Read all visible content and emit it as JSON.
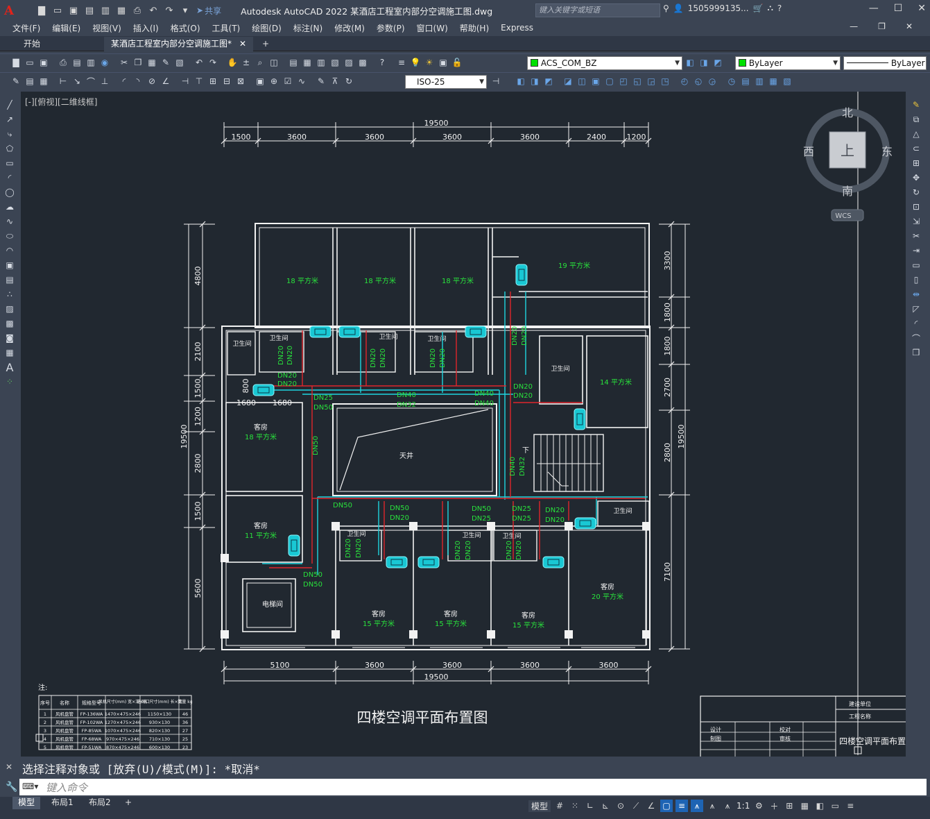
{
  "app": {
    "logo": "A",
    "share": "共享",
    "title": "Autodesk AutoCAD 2022    某酒店工程室内部分空调施工图.dwg",
    "search_placeholder": "键入关键字或短语",
    "user": "1505999135..."
  },
  "menu": [
    "文件(F)",
    "编辑(E)",
    "视图(V)",
    "插入(I)",
    "格式(O)",
    "工具(T)",
    "绘图(D)",
    "标注(N)",
    "修改(M)",
    "参数(P)",
    "窗口(W)",
    "帮助(H)",
    "Express"
  ],
  "tabs": {
    "start": "开始",
    "doc": "某酒店工程室内部分空调施工图*",
    "add": "+"
  },
  "toolbar": {
    "layer": "ACS_COM_BZ",
    "color": "ByLayer",
    "linetype": "ByLayer",
    "dimstyle": "ISO-25"
  },
  "view_label": "[-][俯视][二维线框]",
  "viewcube": {
    "north": "北",
    "south": "南",
    "east": "东",
    "west": "西",
    "top": "上",
    "wcs": "WCS"
  },
  "drawing": {
    "title": "四楼空调平面布置图",
    "total_dim": "19500",
    "top_dims": [
      "1500",
      "3600",
      "3600",
      "3600",
      "3600",
      "2400",
      "1200"
    ],
    "bottom_dims": [
      "5100",
      "3600",
      "3600",
      "3600",
      "3600"
    ],
    "left_dims": [
      "4800",
      "2100",
      "1500",
      "1200",
      "2800",
      "1500",
      "5600"
    ],
    "right_dims": [
      "3300",
      "1800",
      "1800",
      "2700",
      "2800",
      "7100"
    ],
    "rooms": [
      {
        "name": "",
        "area": "18 平方米"
      },
      {
        "name": "",
        "area": "18 平方米"
      },
      {
        "name": "",
        "area": "18 平方米"
      },
      {
        "name": "",
        "area": "19 平方米"
      },
      {
        "name": "",
        "area": "14 平方米"
      },
      {
        "name": "客房",
        "area": "18 平方米"
      },
      {
        "name": "客房",
        "area": "11 平方米"
      },
      {
        "name": "客房",
        "area": "15 平方米"
      },
      {
        "name": "客房",
        "area": "15 平方米"
      },
      {
        "name": "客房",
        "area": "15 平方米"
      },
      {
        "name": "客房",
        "area": "20 平方米"
      }
    ],
    "bath": "卫生间",
    "atrium": "天井",
    "elevator": "电梯间",
    "stair_down": "下",
    "pipe_labels": [
      "DN20",
      "DN25",
      "DN32",
      "DN40",
      "DN50"
    ],
    "dims_small": [
      "1680",
      "1680",
      "800"
    ],
    "note_label": "注:",
    "table": {
      "headers": [
        "序号",
        "名称",
        "规格型号",
        "风机尺寸(mm) 宽×深×高",
        "送风口尺寸(mm) 长×宽",
        "数量 kg"
      ],
      "rows": [
        [
          "1",
          "风机盘管",
          "FP-136WA",
          "1470×475×246",
          "1150×130",
          "46"
        ],
        [
          "2",
          "风机盘管",
          "FP-102WA",
          "1270×475×246",
          "930×130",
          "36"
        ],
        [
          "3",
          "风机盘管",
          "FP-85WA",
          "1070×475×246",
          "820×130",
          "27"
        ],
        [
          "4",
          "风机盘管",
          "FP-68WA",
          "970×475×246",
          "710×130",
          "25"
        ],
        [
          "5",
          "风机盘管",
          "FP-51WA",
          "870×475×246",
          "600×130",
          "23"
        ]
      ]
    },
    "titleblock": {
      "unit": "建设单位",
      "project": "工程名称",
      "design": "设计",
      "check": "校对",
      "draw": "制图",
      "review": "审核",
      "name": "四楼空调平面布置"
    }
  },
  "command": {
    "history": "选择注释对象或 [放弃(U)/模式(M)]: *取消*",
    "placeholder": "键入命令"
  },
  "layouts": [
    "模型",
    "布局1",
    "布局2"
  ],
  "status": {
    "model": "模型",
    "scale": "1:1"
  }
}
